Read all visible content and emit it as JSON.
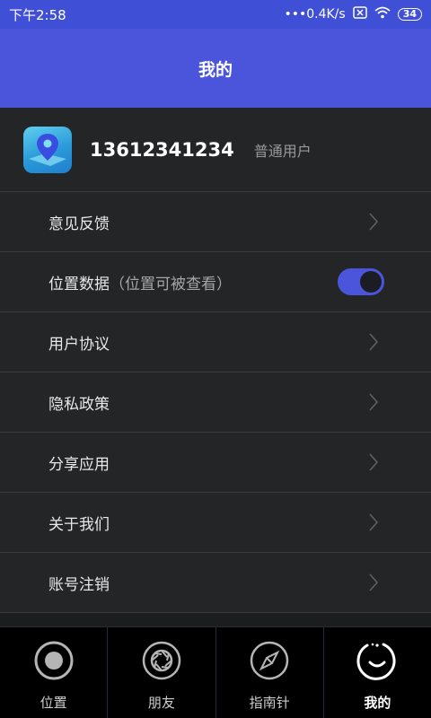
{
  "status_bar": {
    "time": "下午2:58",
    "network_speed": "•••0.4K/s",
    "battery": "34",
    "icons": [
      "sim-x-icon",
      "wifi-icon",
      "battery-icon"
    ]
  },
  "header": {
    "title": "我的"
  },
  "profile": {
    "phone": "13612341234",
    "user_type": "普通用户",
    "icon": "map-pin-icon"
  },
  "menu": {
    "items": [
      {
        "label": "意见反馈"
      },
      {
        "label": "位置数据",
        "hint": "（位置可被查看）",
        "toggle_on": true
      },
      {
        "label": "用户协议"
      },
      {
        "label": "隐私政策"
      },
      {
        "label": "分享应用"
      },
      {
        "label": "关于我们"
      },
      {
        "label": "账号注销"
      }
    ]
  },
  "tabbar": {
    "tabs": [
      {
        "label": "位置",
        "icon": "target-icon"
      },
      {
        "label": "朋友",
        "icon": "aperture-icon"
      },
      {
        "label": "指南针",
        "icon": "compass-icon"
      },
      {
        "label": "我的",
        "icon": "profile-circle-icon",
        "active": true
      }
    ]
  },
  "colors": {
    "header": "#4a55dc",
    "status_bar": "#3f4fd6",
    "background": "#1c1d1f",
    "row": "#232526",
    "accent": "#4a55dc"
  }
}
